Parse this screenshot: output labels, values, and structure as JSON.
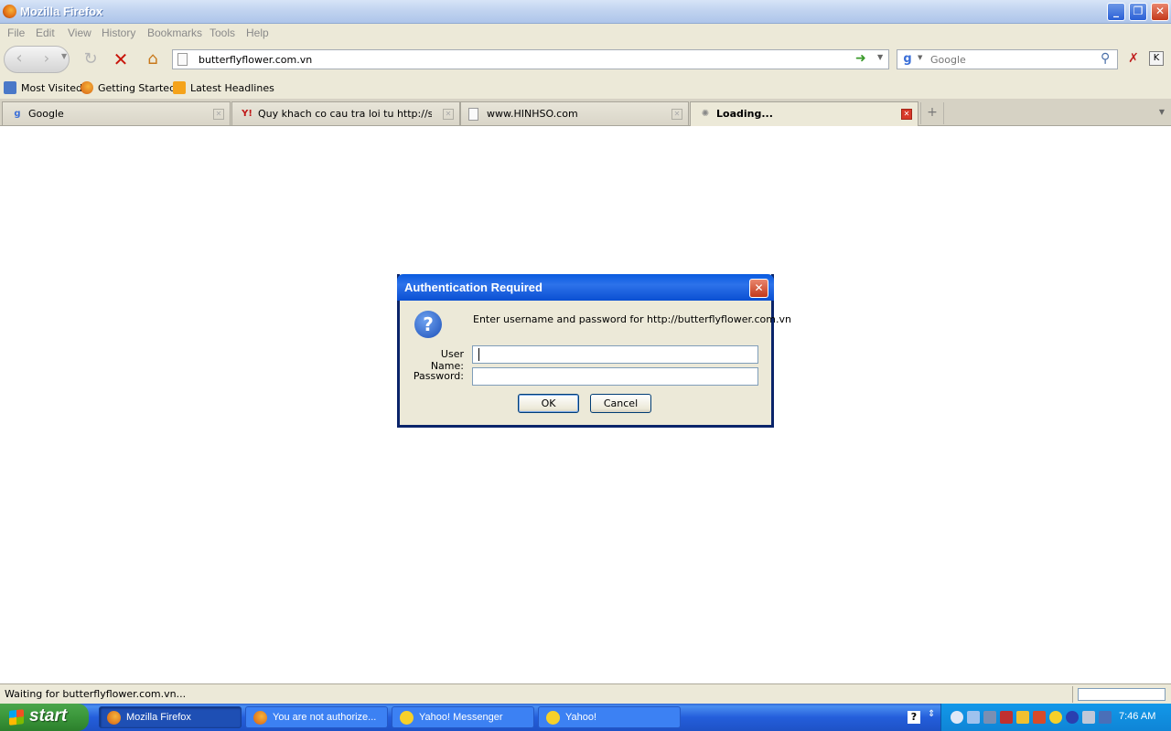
{
  "window": {
    "title": "Mozilla Firefox",
    "controls": {
      "minimize": "_",
      "maximize": "❐",
      "close": "✕"
    }
  },
  "menu": [
    "File",
    "Edit",
    "View",
    "History",
    "Bookmarks",
    "Tools",
    "Help"
  ],
  "nav": {
    "url": "butterflyflower.com.vn",
    "search_placeholder": "Google"
  },
  "bookmarks": [
    "Most Visited",
    "Getting Started",
    "Latest Headlines"
  ],
  "tabs": [
    {
      "label": "Google",
      "active": false
    },
    {
      "label": "Quy khach co cau tra loi tu http://supp...",
      "active": false
    },
    {
      "label": "www.HINHSO.com",
      "active": false
    },
    {
      "label": "Loading...",
      "active": true
    }
  ],
  "dialog": {
    "title": "Authentication Required",
    "message": "Enter username and password for http://butterflyflower.com.vn",
    "username_label": "User Name:",
    "password_label": "Password:",
    "username_value": "",
    "password_value": "",
    "ok": "OK",
    "cancel": "Cancel"
  },
  "status": {
    "text": "Waiting for butterflyflower.com.vn..."
  },
  "taskbar": {
    "start": "start",
    "tasks": [
      "Mozilla Firefox",
      "You are not authorize...",
      "Yahoo! Messenger",
      "Yahoo!"
    ],
    "clock": "7:46 AM"
  },
  "colors": {
    "titlebar_active": "#0a5be0",
    "taskbar": "#245edb",
    "start": "#3a963a",
    "stop": "#c8140a"
  }
}
